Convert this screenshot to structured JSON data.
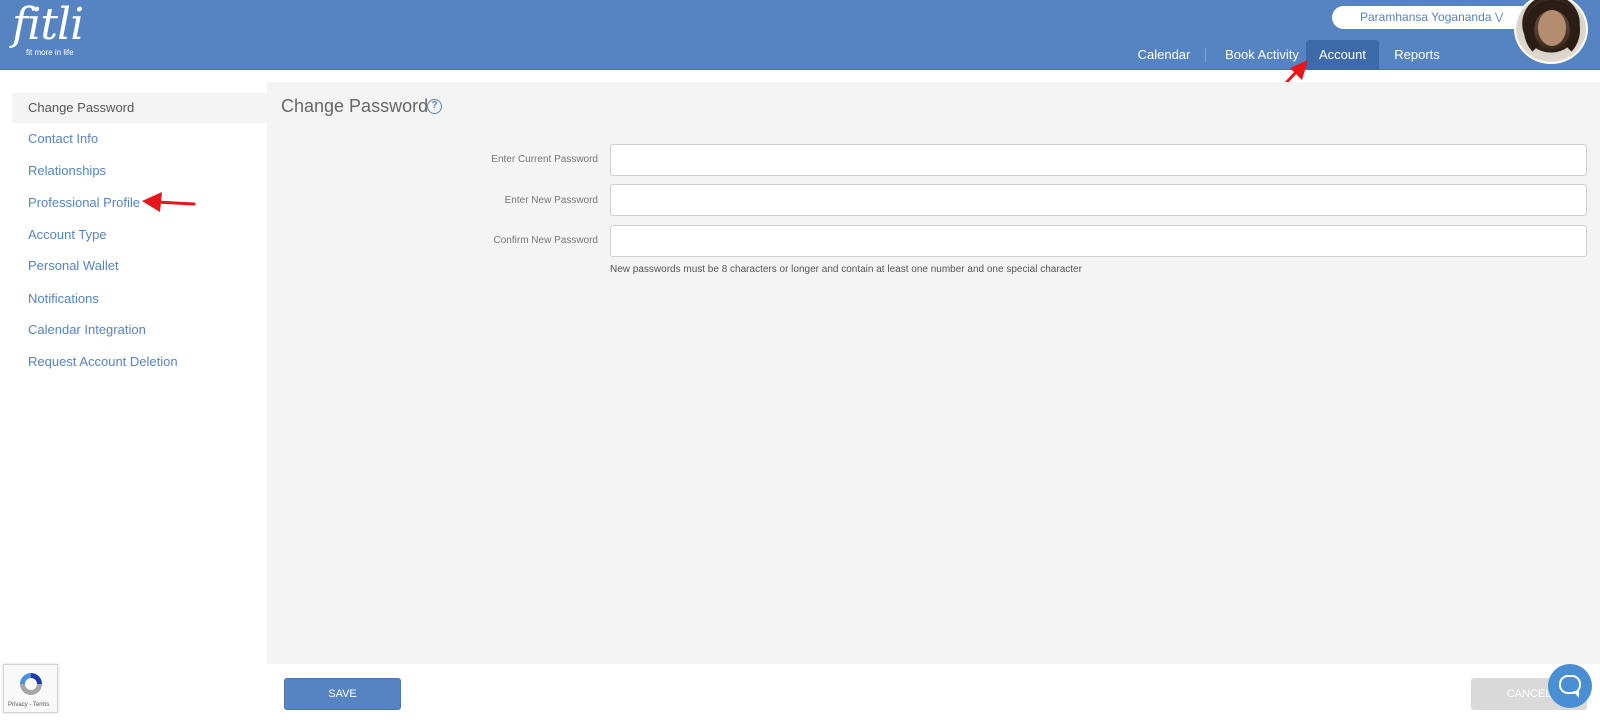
{
  "app": {
    "logo_text": "fitli",
    "logo_tagline": "fit more in life"
  },
  "user": {
    "name": "Paramhansa Yogananda"
  },
  "nav": {
    "calendar": "Calendar",
    "book_activity": "Book Activity",
    "account": "Account",
    "reports": "Reports",
    "active": "Account"
  },
  "sidebar": {
    "items": [
      {
        "label": "Change Password",
        "active": true
      },
      {
        "label": "Contact Info"
      },
      {
        "label": "Relationships"
      },
      {
        "label": "Professional Profile"
      },
      {
        "label": "Account Type"
      },
      {
        "label": "Personal Wallet"
      },
      {
        "label": "Notifications"
      },
      {
        "label": "Calendar Integration"
      },
      {
        "label": "Request Account Deletion"
      }
    ]
  },
  "main": {
    "title": "Change Password",
    "help_glyph": "?",
    "fields": [
      {
        "label": "Enter Current Password",
        "value": ""
      },
      {
        "label": "Enter New Password",
        "value": ""
      },
      {
        "label": "Confirm New Password",
        "value": ""
      }
    ],
    "hint": "New passwords must be 8 characters or longer and contain at least one number and one special character"
  },
  "footer": {
    "save_label": "SAVE",
    "cancel_label": "CANCEL"
  },
  "recaptcha": {
    "text": "Privacy - Terms"
  },
  "colors": {
    "brand": "#5683c2",
    "active_tab": "#3d6aa8",
    "annotation_arrow": "#e8151b"
  }
}
